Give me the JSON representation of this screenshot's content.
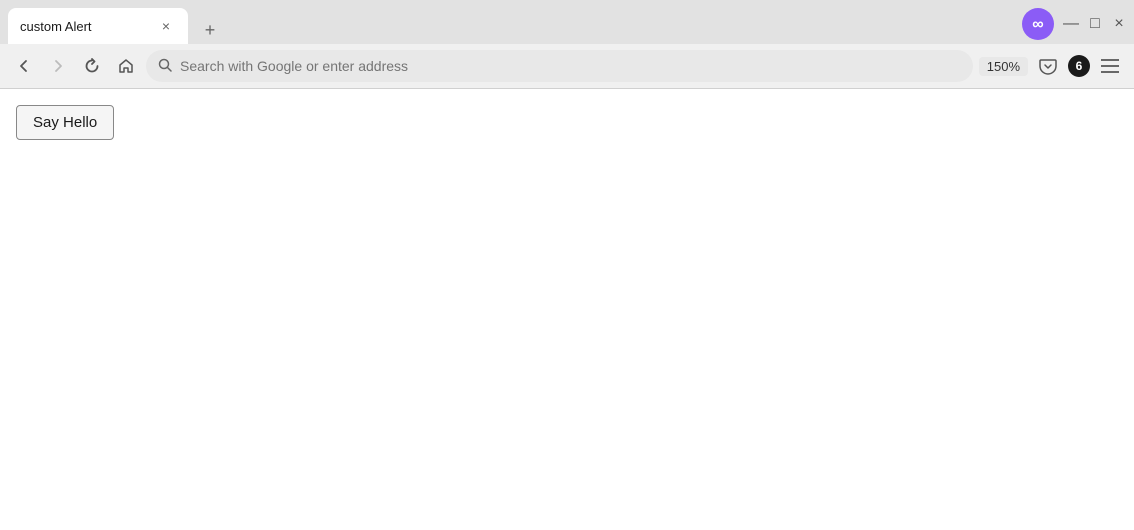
{
  "browser": {
    "tab": {
      "title": "custom Alert",
      "close_label": "×"
    },
    "new_tab_label": "+",
    "window_controls": {
      "minimize": "—",
      "maximize": "□",
      "close": "×"
    },
    "nav": {
      "back_tooltip": "Back",
      "forward_tooltip": "Forward",
      "refresh_tooltip": "Refresh",
      "home_tooltip": "Home"
    },
    "address_bar": {
      "placeholder": "Search with Google or enter address",
      "value": ""
    },
    "zoom": "150%",
    "notification_count": "6",
    "menu_label": "≡"
  },
  "page": {
    "button_label": "Say Hello"
  }
}
